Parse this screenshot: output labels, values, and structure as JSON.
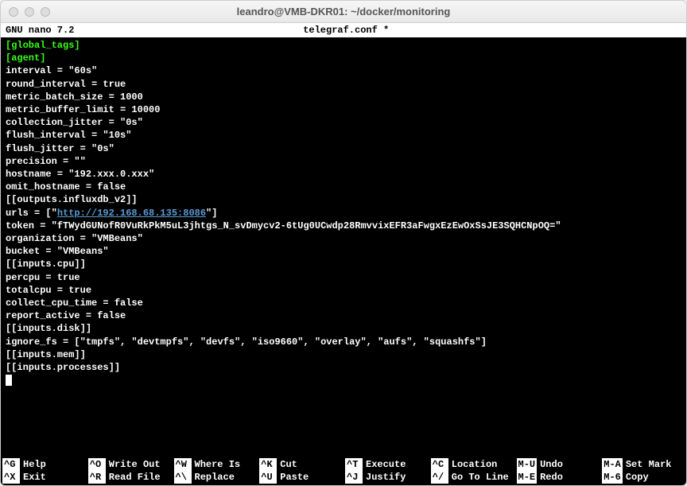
{
  "window": {
    "title": "leandro@VMB-DKR01: ~/docker/monitoring"
  },
  "nano": {
    "version_label": "  GNU nano 7.2",
    "filename": "telegraf.conf *"
  },
  "content": {
    "section_global": "[global_tags]",
    "section_agent": "[agent]",
    "line_interval": "interval = \"60s\"",
    "line_round": "round_interval = true",
    "line_batch": "metric_batch_size = 1000",
    "line_buffer": "metric_buffer_limit = 10000",
    "line_jitter": "collection_jitter = \"0s\"",
    "line_flush_int": "flush_interval = \"10s\"",
    "line_flush_jit": "flush_jitter = \"0s\"",
    "line_precision": "precision = \"\"",
    "line_hostname": "hostname = \"192.xxx.0.xxx\"",
    "line_omit": "omit_hostname = false",
    "line_out_influx": "[[outputs.influxdb_v2]]",
    "line_urls_pre": "urls = [\"",
    "line_urls_link": "http://192.168.68.135:8086",
    "line_urls_post": "\"]",
    "line_token": "token = \"fTWydGUNofR0VuRkPkM5uL3jhtgs_N_svDmycv2-6tUg0UCwdp28RmvvixEFR3aFwgxEzEwOxSsJE3SQHCNpOQ=\"",
    "line_org": "organization = \"VMBeans\"",
    "line_bucket": "bucket = \"VMBeans\"",
    "line_in_cpu": "[[inputs.cpu]]",
    "line_percpu": "percpu = true",
    "line_totalcpu": "totalcpu = true",
    "line_collectcpu": "collect_cpu_time = false",
    "line_reportact": "report_active = false",
    "line_in_disk": "[[inputs.disk]]",
    "line_ignorefs": "ignore_fs = [\"tmpfs\", \"devtmpfs\", \"devfs\", \"iso9660\", \"overlay\", \"aufs\", \"squashfs\"]",
    "line_in_mem": "[[inputs.mem]]",
    "line_in_proc": "[[inputs.processes]]"
  },
  "shortcuts": {
    "row1": [
      {
        "key": "^G",
        "label": "Help"
      },
      {
        "key": "^O",
        "label": "Write Out"
      },
      {
        "key": "^W",
        "label": "Where Is"
      },
      {
        "key": "^K",
        "label": "Cut"
      },
      {
        "key": "^T",
        "label": "Execute"
      },
      {
        "key": "^C",
        "label": "Location"
      },
      {
        "key": "M-U",
        "label": "Undo"
      },
      {
        "key": "M-A",
        "label": "Set Mark"
      }
    ],
    "row2": [
      {
        "key": "^X",
        "label": "Exit"
      },
      {
        "key": "^R",
        "label": "Read File"
      },
      {
        "key": "^\\",
        "label": "Replace"
      },
      {
        "key": "^U",
        "label": "Paste"
      },
      {
        "key": "^J",
        "label": "Justify"
      },
      {
        "key": "^/",
        "label": "Go To Line"
      },
      {
        "key": "M-E",
        "label": "Redo"
      },
      {
        "key": "M-6",
        "label": "Copy"
      }
    ]
  }
}
